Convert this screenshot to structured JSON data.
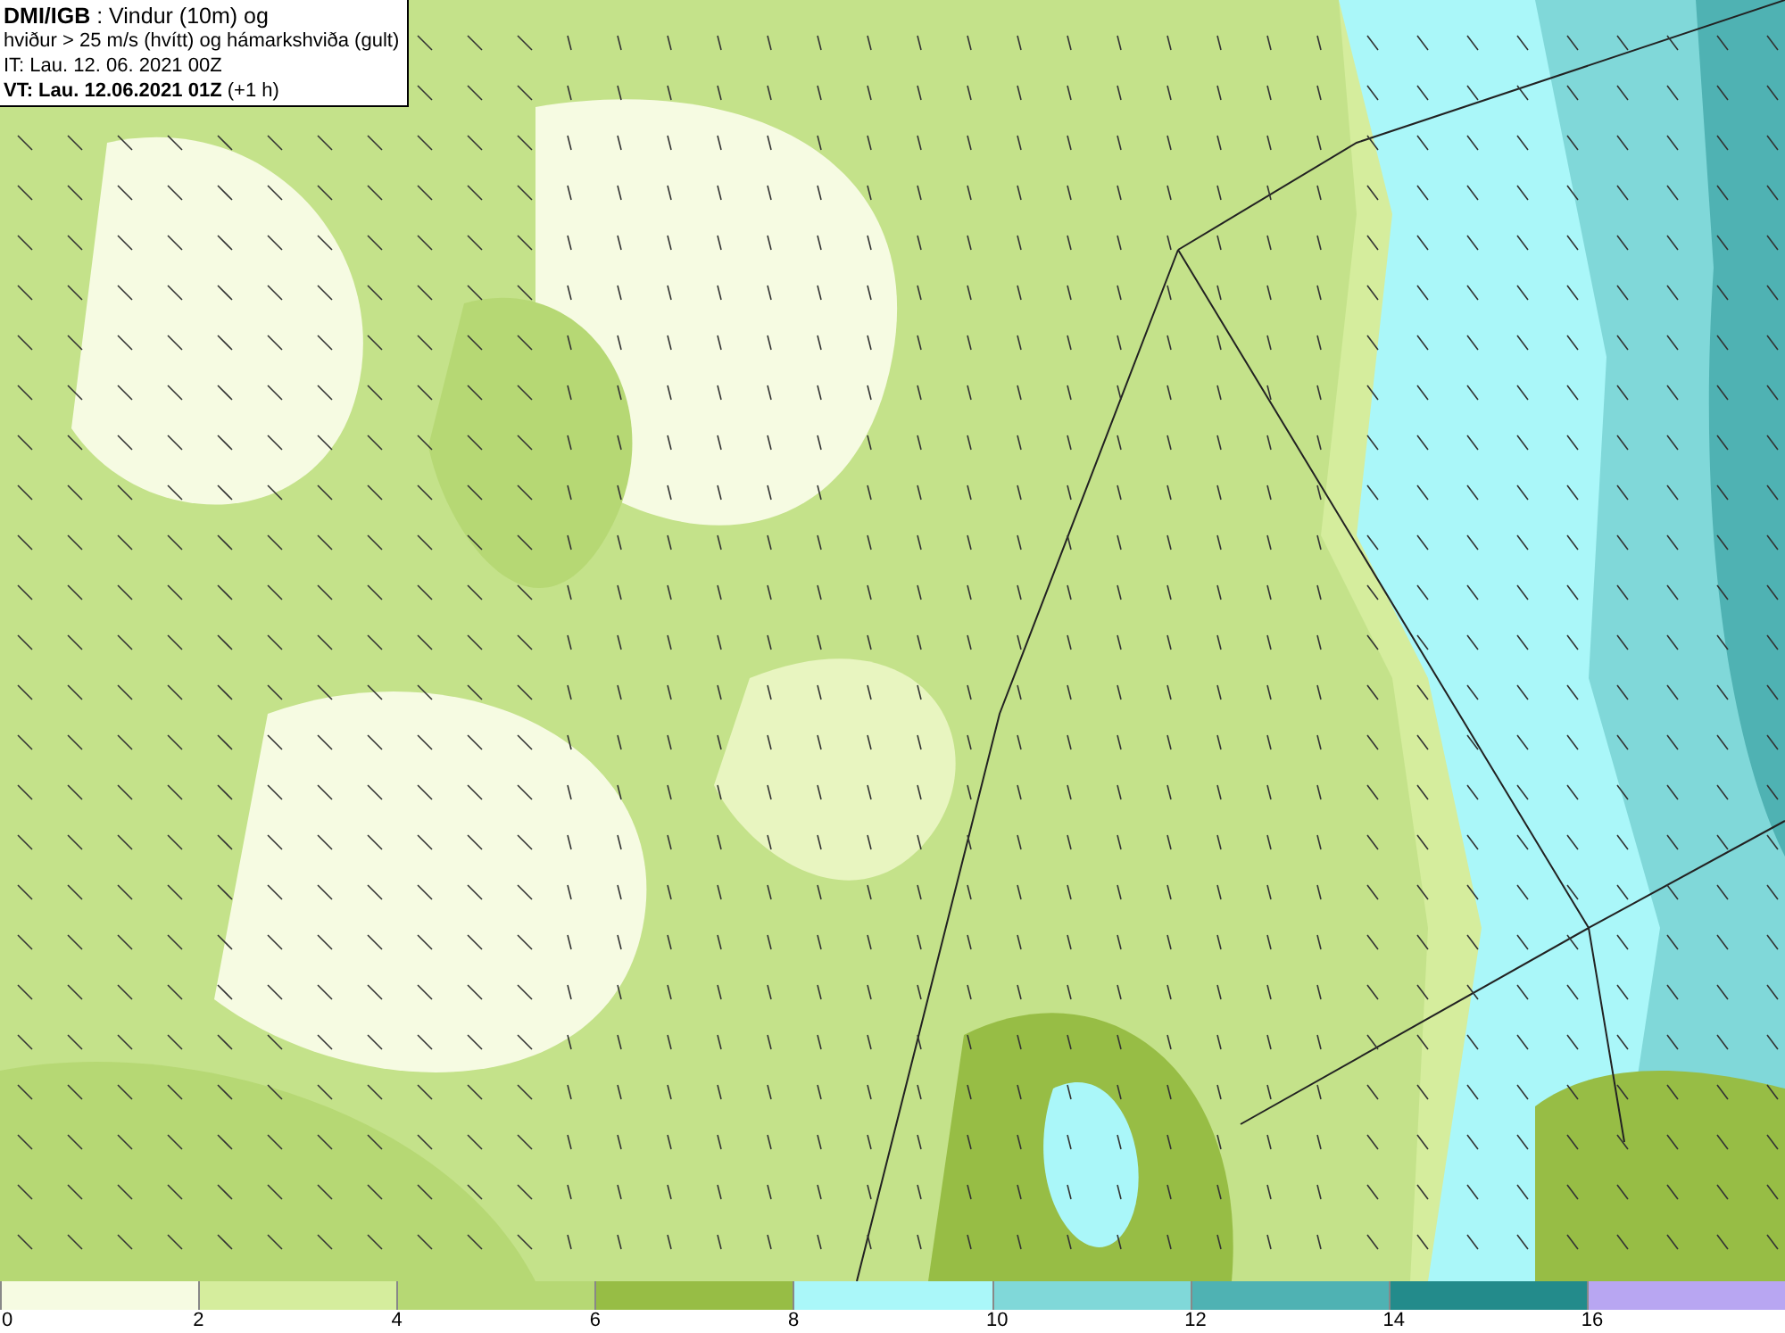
{
  "title_box": {
    "lines": [
      "**DMI/IGB** : Vindur (10m) og",
      "hviður > 25 m/s (hvítt) og hámarkshviða (gult)",
      "IT: Lau. 12. 06. 2021 00Z",
      "**VT: Lau. 12.06.2021 01Z** (+1 h)"
    ]
  },
  "legend": [
    {
      "label": "0",
      "color": "#f6fbe2"
    },
    {
      "label": "2",
      "color": "#d5ed9d"
    },
    {
      "label": "4",
      "color": "#b6d874"
    },
    {
      "label": "6",
      "color": "#97bd45"
    },
    {
      "label": "8",
      "color": "#aaf7f9"
    },
    {
      "label": "10",
      "color": "#80d8d9"
    },
    {
      "label": "12",
      "color": "#4fb2b3"
    },
    {
      "label": "14",
      "color": "#238b8b"
    },
    {
      "label": "16",
      "color": "#b8a6f2"
    }
  ]
}
